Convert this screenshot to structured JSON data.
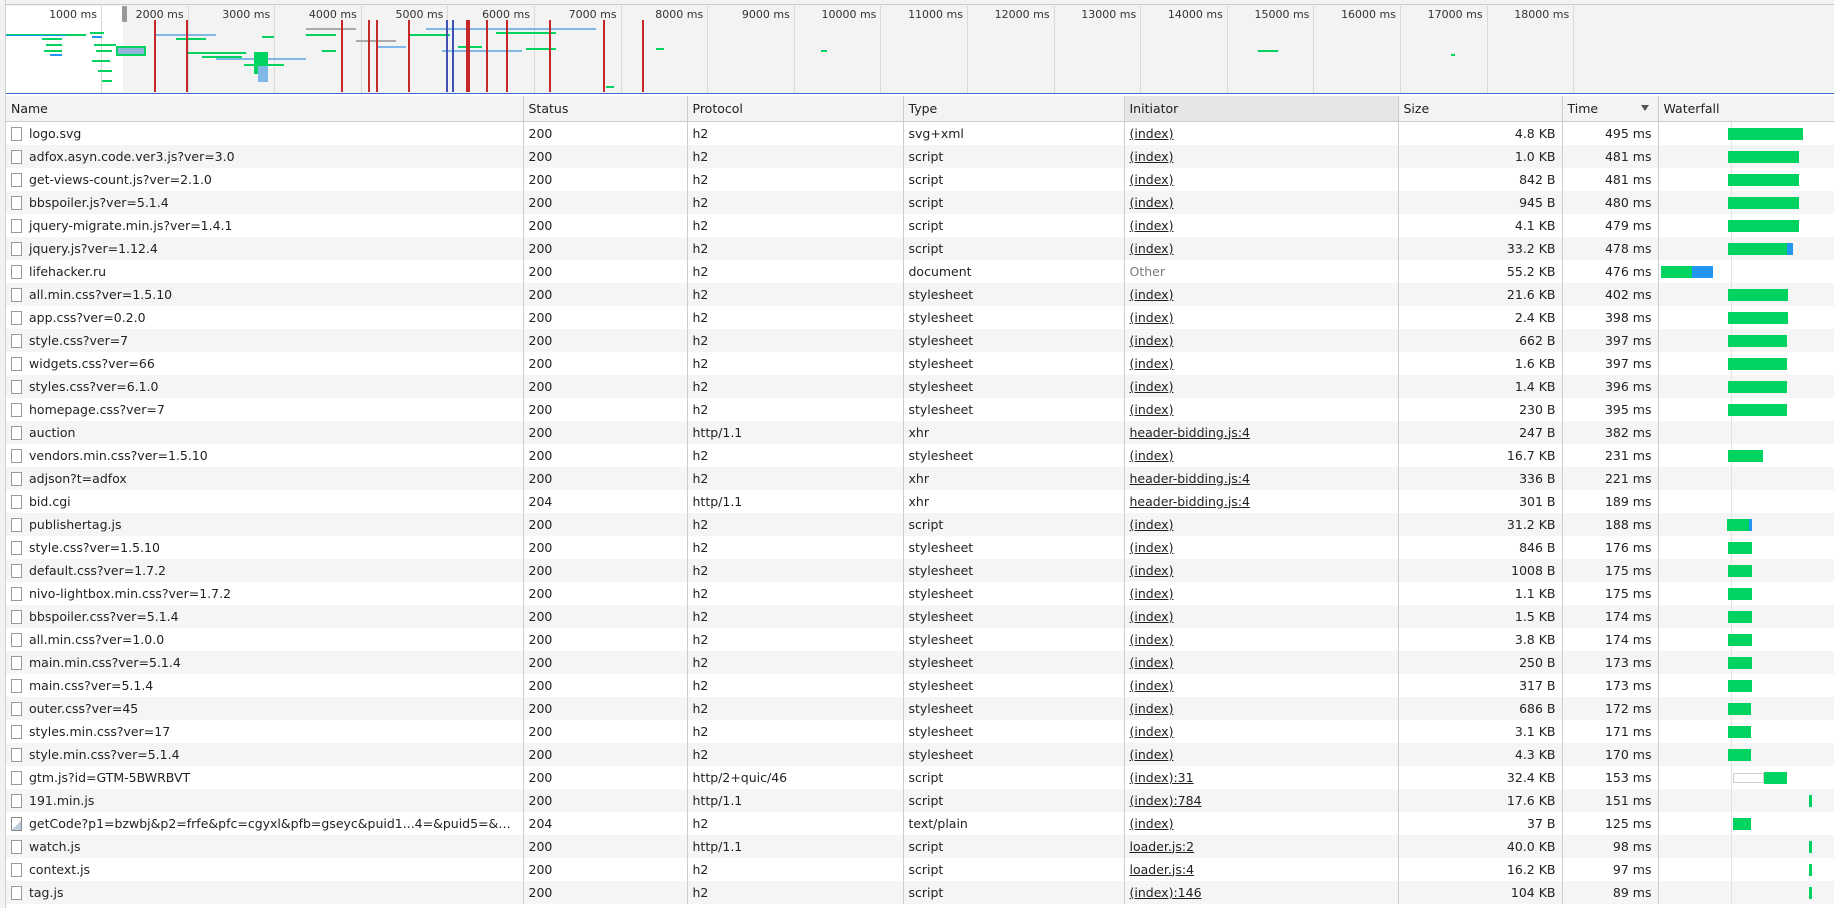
{
  "colors": {
    "waterfall_receive": "#00d35f",
    "waterfall_download": "#2196f3",
    "overview_load_line": "#c62828",
    "overview_dcl_line": "#3f51b5"
  },
  "overview": {
    "tick_labels": [
      "1000 ms",
      "2000 ms",
      "3000 ms",
      "4000 ms",
      "5000 ms",
      "6000 ms",
      "7000 ms",
      "8000 ms",
      "9000 ms",
      "10000 ms",
      "11000 ms",
      "12000 ms",
      "13000 ms",
      "14000 ms",
      "15000 ms",
      "16000 ms",
      "17000 ms",
      "18000 ms"
    ]
  },
  "columns": {
    "name": "Name",
    "status": "Status",
    "protocol": "Protocol",
    "type": "Type",
    "initiator": "Initiator",
    "size": "Size",
    "time": "Time",
    "waterfall": "Waterfall"
  },
  "rows": [
    {
      "name": "logo.svg",
      "status": "200",
      "protocol": "h2",
      "type": "svg+xml",
      "initiator": "(index)",
      "size": "4.8 KB",
      "time": "495 ms",
      "wf": {
        "start": 0.45,
        "len": 0.5
      }
    },
    {
      "name": "adfox.asyn.code.ver3.js?ver=3.0",
      "status": "200",
      "protocol": "h2",
      "type": "script",
      "initiator": "(index)",
      "size": "1.0 KB",
      "time": "481 ms",
      "wf": {
        "start": 0.45,
        "len": 0.47
      }
    },
    {
      "name": "get-views-count.js?ver=2.1.0",
      "status": "200",
      "protocol": "h2",
      "type": "script",
      "initiator": "(index)",
      "size": "842 B",
      "time": "481 ms",
      "wf": {
        "start": 0.45,
        "len": 0.47
      }
    },
    {
      "name": "bbspoiler.js?ver=5.1.4",
      "status": "200",
      "protocol": "h2",
      "type": "script",
      "initiator": "(index)",
      "size": "945 B",
      "time": "480 ms",
      "wf": {
        "start": 0.45,
        "len": 0.47
      }
    },
    {
      "name": "jquery-migrate.min.js?ver=1.4.1",
      "status": "200",
      "protocol": "h2",
      "type": "script",
      "initiator": "(index)",
      "size": "4.1 KB",
      "time": "479 ms",
      "wf": {
        "start": 0.45,
        "len": 0.47
      }
    },
    {
      "name": "jquery.js?ver=1.12.4",
      "status": "200",
      "protocol": "h2",
      "type": "script",
      "initiator": "(index)",
      "size": "33.2 KB",
      "time": "478 ms",
      "wf": {
        "start": 0.45,
        "len": 0.43,
        "blue": 0.04
      }
    },
    {
      "name": "lifehacker.ru",
      "status": "200",
      "protocol": "h2",
      "type": "document",
      "initiator": "Other",
      "initiator_other": true,
      "size": "55.2 KB",
      "time": "476 ms",
      "wf": {
        "start": 0.0,
        "len": 0.35,
        "blue": 0.14
      }
    },
    {
      "name": "all.min.css?ver=1.5.10",
      "status": "200",
      "protocol": "h2",
      "type": "stylesheet",
      "initiator": "(index)",
      "size": "21.6 KB",
      "time": "402 ms",
      "wf": {
        "start": 0.45,
        "len": 0.4
      }
    },
    {
      "name": "app.css?ver=0.2.0",
      "status": "200",
      "protocol": "h2",
      "type": "stylesheet",
      "initiator": "(index)",
      "size": "2.4 KB",
      "time": "398 ms",
      "wf": {
        "start": 0.45,
        "len": 0.4
      }
    },
    {
      "name": "style.css?ver=7",
      "status": "200",
      "protocol": "h2",
      "type": "stylesheet",
      "initiator": "(index)",
      "size": "662 B",
      "time": "397 ms",
      "wf": {
        "start": 0.45,
        "len": 0.39
      }
    },
    {
      "name": "widgets.css?ver=66",
      "status": "200",
      "protocol": "h2",
      "type": "stylesheet",
      "initiator": "(index)",
      "size": "1.6 KB",
      "time": "397 ms",
      "wf": {
        "start": 0.45,
        "len": 0.39
      }
    },
    {
      "name": "styles.css?ver=6.1.0",
      "status": "200",
      "protocol": "h2",
      "type": "stylesheet",
      "initiator": "(index)",
      "size": "1.4 KB",
      "time": "396 ms",
      "wf": {
        "start": 0.45,
        "len": 0.39
      }
    },
    {
      "name": "homepage.css?ver=7",
      "status": "200",
      "protocol": "h2",
      "type": "stylesheet",
      "initiator": "(index)",
      "size": "230 B",
      "time": "395 ms",
      "wf": {
        "start": 0.45,
        "len": 0.39
      }
    },
    {
      "name": "auction",
      "status": "200",
      "protocol": "http/1.1",
      "type": "xhr",
      "initiator": "header-bidding.js:4",
      "size": "247 B",
      "time": "382 ms",
      "wf": null
    },
    {
      "name": "vendors.min.css?ver=1.5.10",
      "status": "200",
      "protocol": "h2",
      "type": "stylesheet",
      "initiator": "(index)",
      "size": "16.7 KB",
      "time": "231 ms",
      "wf": {
        "start": 0.45,
        "len": 0.23
      }
    },
    {
      "name": "adjson?t=adfox",
      "status": "200",
      "protocol": "h2",
      "type": "xhr",
      "initiator": "header-bidding.js:4",
      "size": "336 B",
      "time": "221 ms",
      "wf": null
    },
    {
      "name": "bid.cgi",
      "status": "204",
      "protocol": "http/1.1",
      "type": "xhr",
      "initiator": "header-bidding.js:4",
      "size": "301 B",
      "time": "189 ms",
      "wf": null
    },
    {
      "name": "publishertag.js",
      "status": "200",
      "protocol": "h2",
      "type": "script",
      "initiator": "(index)",
      "size": "31.2 KB",
      "time": "188 ms",
      "wf": {
        "start": 0.44,
        "len": 0.17,
        "blue": 0.02
      }
    },
    {
      "name": "style.css?ver=1.5.10",
      "status": "200",
      "protocol": "h2",
      "type": "stylesheet",
      "initiator": "(index)",
      "size": "846 B",
      "time": "176 ms",
      "wf": {
        "start": 0.45,
        "len": 0.16
      }
    },
    {
      "name": "default.css?ver=1.7.2",
      "status": "200",
      "protocol": "h2",
      "type": "stylesheet",
      "initiator": "(index)",
      "size": "1008 B",
      "time": "175 ms",
      "wf": {
        "start": 0.45,
        "len": 0.16
      }
    },
    {
      "name": "nivo-lightbox.min.css?ver=1.7.2",
      "status": "200",
      "protocol": "h2",
      "type": "stylesheet",
      "initiator": "(index)",
      "size": "1.1 KB",
      "time": "175 ms",
      "wf": {
        "start": 0.45,
        "len": 0.16
      }
    },
    {
      "name": "bbspoiler.css?ver=5.1.4",
      "status": "200",
      "protocol": "h2",
      "type": "stylesheet",
      "initiator": "(index)",
      "size": "1.5 KB",
      "time": "174 ms",
      "wf": {
        "start": 0.45,
        "len": 0.16
      }
    },
    {
      "name": "all.min.css?ver=1.0.0",
      "status": "200",
      "protocol": "h2",
      "type": "stylesheet",
      "initiator": "(index)",
      "size": "3.8 KB",
      "time": "174 ms",
      "wf": {
        "start": 0.45,
        "len": 0.16
      }
    },
    {
      "name": "main.min.css?ver=5.1.4",
      "status": "200",
      "protocol": "h2",
      "type": "stylesheet",
      "initiator": "(index)",
      "size": "250 B",
      "time": "173 ms",
      "wf": {
        "start": 0.45,
        "len": 0.16
      }
    },
    {
      "name": "main.css?ver=5.1.4",
      "status": "200",
      "protocol": "h2",
      "type": "stylesheet",
      "initiator": "(index)",
      "size": "317 B",
      "time": "173 ms",
      "wf": {
        "start": 0.45,
        "len": 0.16
      }
    },
    {
      "name": "outer.css?ver=45",
      "status": "200",
      "protocol": "h2",
      "type": "stylesheet",
      "initiator": "(index)",
      "size": "686 B",
      "time": "172 ms",
      "wf": {
        "start": 0.45,
        "len": 0.15
      }
    },
    {
      "name": "styles.min.css?ver=17",
      "status": "200",
      "protocol": "h2",
      "type": "stylesheet",
      "initiator": "(index)",
      "size": "3.1 KB",
      "time": "171 ms",
      "wf": {
        "start": 0.45,
        "len": 0.15
      }
    },
    {
      "name": "style.min.css?ver=5.1.4",
      "status": "200",
      "protocol": "h2",
      "type": "stylesheet",
      "initiator": "(index)",
      "size": "4.3 KB",
      "time": "170 ms",
      "wf": {
        "start": 0.45,
        "len": 0.15
      }
    },
    {
      "name": "gtm.js?id=GTM-5BWRBVT",
      "status": "200",
      "protocol": "http/2+quic/46",
      "type": "script",
      "initiator": "(index):31",
      "size": "32.4 KB",
      "time": "153 ms",
      "wf": {
        "start": 0.69,
        "len": 0.15,
        "wait_start": 0.48,
        "wait_len": 0.21
      }
    },
    {
      "name": "191.min.js",
      "status": "200",
      "protocol": "http/1.1",
      "type": "script",
      "initiator": "(index):784",
      "size": "17.6 KB",
      "time": "151 ms",
      "wf": {
        "start": 0.99,
        "len": 0.02
      }
    },
    {
      "name": "getCode?p1=bzwbj&p2=frfe&pfc=cgyxl&pfb=gseyc&puid1...4=&puid5=&puid6...",
      "image_icon": true,
      "status": "204",
      "protocol": "h2",
      "type": "text/plain",
      "initiator": "(index)",
      "size": "37 B",
      "time": "125 ms",
      "wf": {
        "start": 0.48,
        "len": 0.12
      }
    },
    {
      "name": "watch.js",
      "status": "200",
      "protocol": "http/1.1",
      "type": "script",
      "initiator": "loader.js:2",
      "size": "40.0 KB",
      "time": "98 ms",
      "wf": {
        "start": 0.99,
        "len": 0.02
      }
    },
    {
      "name": "context.js",
      "status": "200",
      "protocol": "h2",
      "type": "script",
      "initiator": "loader.js:4",
      "size": "16.2 KB",
      "time": "97 ms",
      "wf": {
        "start": 0.99,
        "len": 0.02
      }
    },
    {
      "name": "tag.js",
      "status": "200",
      "protocol": "h2",
      "type": "script",
      "initiator": "(index):146",
      "size": "104 KB",
      "time": "89 ms",
      "wf": {
        "start": 0.99,
        "len": 0.02
      }
    }
  ]
}
